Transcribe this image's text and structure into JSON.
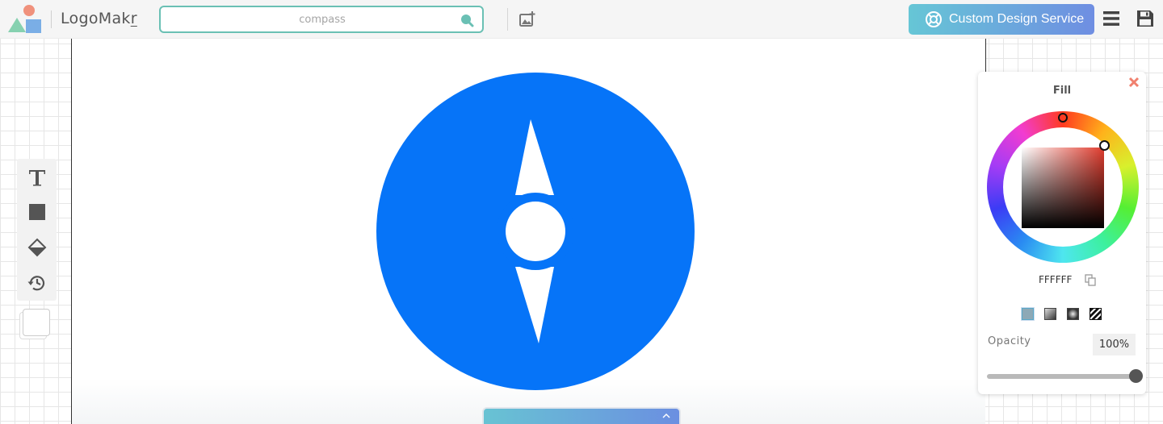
{
  "app": {
    "name_main": "LogoMak",
    "name_underlined": "r"
  },
  "search": {
    "placeholder": "compass"
  },
  "header": {
    "custom_design_label": "Custom Design Service"
  },
  "fill_panel": {
    "title": "Fill",
    "hex": "FFFFFF",
    "opacity_label": "Opacity",
    "opacity_value": "100%",
    "opacity_level": 1.0,
    "fill_types": [
      "solid",
      "linear-gradient",
      "radial-gradient",
      "pattern"
    ]
  },
  "canvas": {
    "shape": "compass",
    "color": "#0674f8"
  },
  "colors": {
    "accent_teal": "#6ac0b4",
    "button_gradient_start": "#66c6d6",
    "button_gradient_end": "#6f8ee2",
    "close_red": "#f0806e"
  },
  "icons": {
    "search": "search-icon",
    "upload": "image-upload-icon",
    "custom_design": "lifebuoy-icon",
    "menu": "hamburger-menu-icon",
    "save": "floppy-disk-icon",
    "text_tool": "text-tool-icon",
    "shape_tool": "square-shape-icon",
    "fill_tool": "paint-bucket-icon",
    "history": "history-icon",
    "close": "close-icon",
    "copy": "copy-icon",
    "chevron": "chevron-up-icon"
  }
}
